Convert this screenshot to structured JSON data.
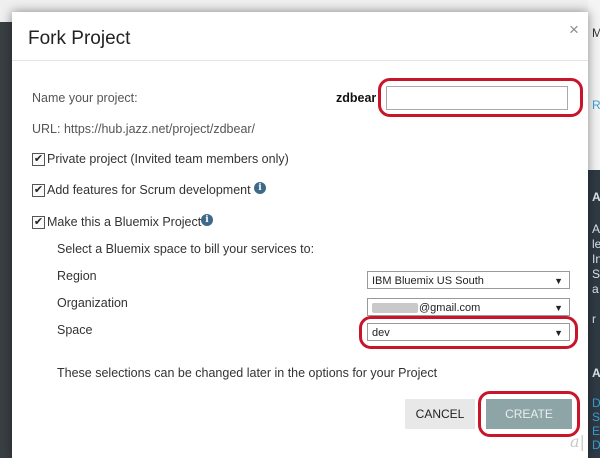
{
  "modal": {
    "title": "Fork Project",
    "close_glyph": "×"
  },
  "form": {
    "name_label": "Name your project:",
    "owner_name": "zdbear",
    "project_name_value": "",
    "url_label": "URL: https://hub.jazz.net/project/zdbear/",
    "private_label": "Private project (Invited team members only)",
    "private_checked": true,
    "scrum_label": "Add features for Scrum development",
    "scrum_checked": true,
    "bluemix_label": "Make this a Bluemix Project",
    "bluemix_checked": true,
    "bluemix_prompt": "Select a Bluemix space to bill your services to:",
    "region_label": "Region",
    "region_value": "IBM Bluemix US South",
    "organization_label": "Organization",
    "organization_value": "@gmail.com",
    "space_label": "Space",
    "space_value": "dev",
    "footnote": "These selections can be changed later in the options for your Project",
    "check_glyph": "✔",
    "info_glyph": "i"
  },
  "buttons": {
    "cancel": "CANCEL",
    "create": "CREATE"
  },
  "background": {
    "right_letters": [
      "M",
      "R",
      "A",
      "A",
      "le",
      "In",
      "S",
      "a",
      "r",
      "A",
      "D",
      "S",
      "E",
      "D"
    ]
  },
  "watermark": "a|",
  "colors": {
    "highlight_ring": "#c8152a",
    "create_button": "#8ea5a8",
    "info_icon": "#3d6a88"
  },
  "icons": {
    "close": "close-icon",
    "info": "info-icon",
    "dropdown": "chevron-down-icon",
    "checkbox": "checkmark-icon"
  }
}
